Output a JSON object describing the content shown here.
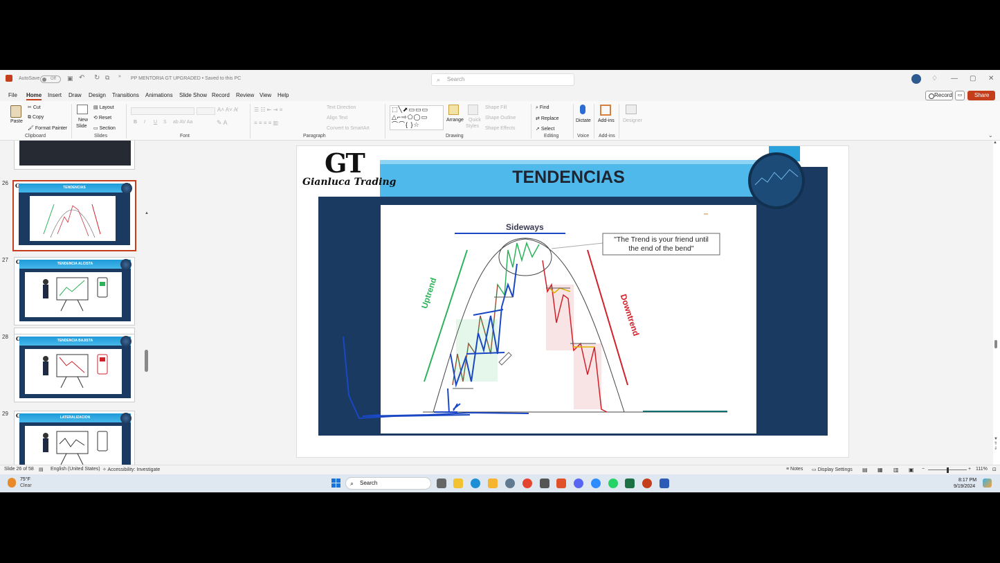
{
  "titlebar": {
    "autosave_label": "AutoSave",
    "autosave_state": "Off",
    "document_title": "PP MENTORIA GT UPGRADED • Saved to this PC",
    "search_placeholder": "Search"
  },
  "menu": {
    "tabs": [
      "File",
      "Home",
      "Insert",
      "Draw",
      "Design",
      "Transitions",
      "Animations",
      "Slide Show",
      "Record",
      "Review",
      "View",
      "Help"
    ],
    "active": "Home",
    "record_label": "Record",
    "share_label": "Share"
  },
  "ribbon": {
    "clipboard": {
      "paste": "Paste",
      "cut": "Cut",
      "copy": "Copy",
      "format_painter": "Format Painter",
      "label": "Clipboard"
    },
    "slides": {
      "new_slide_1": "New",
      "new_slide_2": "Slide",
      "layout": "Layout",
      "reset": "Reset",
      "section": "Section",
      "label": "Slides"
    },
    "font": {
      "label": "Font",
      "bold": "B",
      "italic": "I",
      "underline": "U",
      "strike": "S"
    },
    "paragraph": {
      "text_direction": "Text Direction",
      "align_text": "Align Text",
      "convert_smartart": "Convert to SmartArt",
      "label": "Paragraph"
    },
    "drawing": {
      "arrange": "Arrange",
      "quick_styles_1": "Quick",
      "quick_styles_2": "Styles",
      "shape_fill": "Shape Fill",
      "shape_outline": "Shape Outline",
      "shape_effects": "Shape Effects",
      "label": "Drawing"
    },
    "editing": {
      "find": "Find",
      "replace": "Replace",
      "select": "Select",
      "label": "Editing"
    },
    "voice": {
      "dictate": "Dictate",
      "label": "Voice"
    },
    "addins": {
      "addins": "Add-ins",
      "label": "Add-ins"
    },
    "designer": {
      "designer": "Designer"
    }
  },
  "thumbnails": [
    {
      "number": "26",
      "title": "TENDENCIAS",
      "selected": true
    },
    {
      "number": "27",
      "title": "TENDENCIA ALCISTA",
      "selected": false
    },
    {
      "number": "28",
      "title": "TENDENCIA BAJISTA",
      "selected": false
    },
    {
      "number": "29",
      "title": "LATERALIZACION",
      "selected": false
    }
  ],
  "slide": {
    "logo_letters": "GT",
    "logo_script": "Gianluca Trading",
    "title": "TENDENCIAS",
    "sideways_label": "Sideways",
    "uptrend_label": "Uptrend",
    "downtrend_label": "Downtrend",
    "quote_line1": "\"The Trend is your friend until",
    "quote_line2": "the end of the bend\"",
    "colors": {
      "title_band": "#4fb9ec",
      "frame": "#1b3a61",
      "uptrend": "#2bb35a",
      "downtrend": "#d0202a",
      "pen": "#1a47c4"
    }
  },
  "status": {
    "slide_counter": "Slide 26 of 58",
    "language": "English (United States)",
    "accessibility": "Accessibility: Investigate",
    "notes": "Notes",
    "display_settings": "Display Settings",
    "zoom": "111%"
  },
  "taskbar": {
    "weather_temp": "75°F",
    "weather_desc": "Clear",
    "search_label": "Search",
    "time": "8:17 PM",
    "date": "9/19/2024"
  }
}
